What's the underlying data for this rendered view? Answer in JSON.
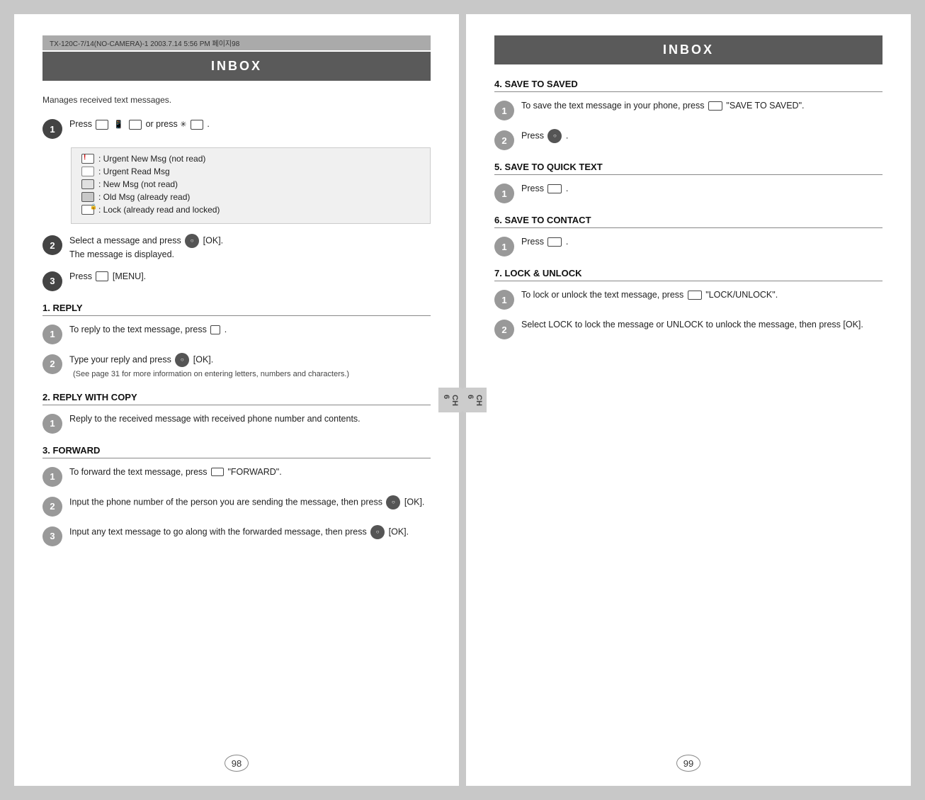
{
  "spread": {
    "left_page": {
      "header": "INBOX",
      "subtitle": "Manages received text messages.",
      "page_number": "98",
      "chapter_tab": "CH\n6",
      "top_bar_text": "TX-120C-7/14(NO-CAMERA)-1  2003.7.14  5:56 PM  페이지98",
      "step1_label": "1",
      "step1_text": "Press",
      "step1_icons": "📞 or press",
      "step2_label": "2",
      "step2_text": "Select a message and press",
      "step2_suffix": "[OK]. The message is displayed.",
      "step3_label": "3",
      "step3_text": "Press",
      "step3_suffix": "[MENU].",
      "icon_table": {
        "rows": [
          {
            "icon": "urgent-new",
            "label": ": Urgent New Msg (not read)"
          },
          {
            "icon": "urgent-read",
            "label": ": Urgent Read Msg"
          },
          {
            "icon": "new",
            "label": ": New Msg (not read)"
          },
          {
            "icon": "old",
            "label": ": Old Msg (already read)"
          },
          {
            "icon": "lock",
            "label": ": Lock (already read and locked)"
          }
        ]
      },
      "sections": [
        {
          "id": "reply",
          "title": "1. REPLY",
          "steps": [
            {
              "num": "1",
              "text": "To reply to the text message, press ."
            },
            {
              "num": "2",
              "text": "Type your reply and press  [OK]. (See page 31 for more information on entering letters, numbers and characters.)"
            }
          ]
        },
        {
          "id": "reply-copy",
          "title": "2. REPLY WITH COPY",
          "steps": [
            {
              "num": "1",
              "text": "Reply to the received message with received phone number and contents."
            }
          ]
        },
        {
          "id": "forward",
          "title": "3. FORWARD",
          "steps": [
            {
              "num": "1",
              "text": "To forward the text message, press  \"FORWARD\"."
            },
            {
              "num": "2",
              "text": "Input the phone number of the person you are sending the message, then press  [OK]."
            },
            {
              "num": "3",
              "text": "Input any text message to go along with the forwarded message, then press  [OK]."
            }
          ]
        }
      ]
    },
    "right_page": {
      "header": "INBOX",
      "page_number": "99",
      "chapter_tab": "CH\n6",
      "sections": [
        {
          "id": "save-to-saved",
          "title": "4. SAVE TO SAVED",
          "steps": [
            {
              "num": "1",
              "text": "To save the text message in your phone, press  \"SAVE TO SAVED\"."
            },
            {
              "num": "2",
              "text": "Press ."
            }
          ]
        },
        {
          "id": "save-to-quick-text",
          "title": "5. SAVE TO QUICK TEXT",
          "steps": [
            {
              "num": "1",
              "text": "Press ."
            }
          ]
        },
        {
          "id": "save-to-contact",
          "title": "6. SAVE TO CONTACT",
          "steps": [
            {
              "num": "1",
              "text": "Press ."
            }
          ]
        },
        {
          "id": "lock-unlock",
          "title": "7. LOCK & UNLOCK",
          "steps": [
            {
              "num": "1",
              "text": "To lock or unlock the text message, press  \"LOCK/UNLOCK\"."
            },
            {
              "num": "2",
              "text": "Select LOCK to lock the message or UNLOCK to unlock the message, then press  [OK]."
            }
          ]
        }
      ]
    }
  }
}
